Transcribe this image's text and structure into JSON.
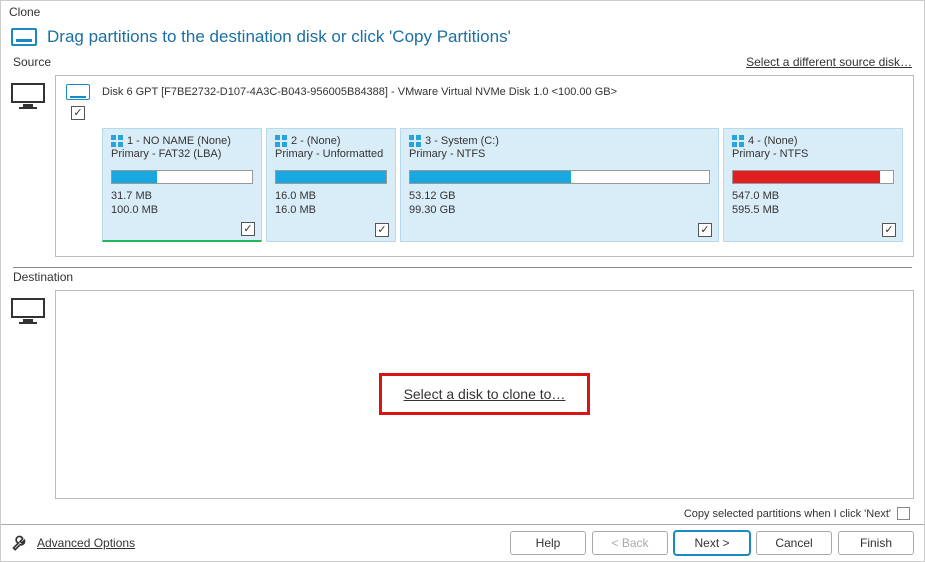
{
  "window": {
    "title": "Clone"
  },
  "instruction": "Drag partitions to the destination disk or click 'Copy Partitions'",
  "source": {
    "label": "Source",
    "select_other_link": "Select a different source disk…",
    "disk_title": "Disk 6 GPT [F7BE2732-D107-4A3C-B043-956005B84388] - VMware Virtual NVMe Disk 1.0  <100.00 GB>",
    "partitions": [
      {
        "title": "1 - NO NAME (None)",
        "type": "Primary - FAT32 (LBA)",
        "used": "31.7 MB",
        "total": "100.0 MB",
        "fill_pct": 32,
        "color": "blue",
        "checked": true
      },
      {
        "title": "2 -   (None)",
        "type": "Primary - Unformatted",
        "used": "16.0 MB",
        "total": "16.0 MB",
        "fill_pct": 100,
        "color": "blue",
        "checked": true
      },
      {
        "title": "3 - System (C:)",
        "type": "Primary - NTFS",
        "used": "53.12 GB",
        "total": "99.30 GB",
        "fill_pct": 54,
        "color": "blue",
        "checked": true
      },
      {
        "title": "4 -   (None)",
        "type": "Primary - NTFS",
        "used": "547.0 MB",
        "total": "595.5 MB",
        "fill_pct": 92,
        "color": "red",
        "checked": true
      }
    ]
  },
  "destination": {
    "label": "Destination",
    "select_link": "Select a disk to clone to…"
  },
  "copy_checkbox_label": "Copy selected partitions when I click 'Next'",
  "footer": {
    "advanced": "Advanced Options",
    "help": "Help",
    "back": "< Back",
    "next": "Next >",
    "cancel": "Cancel",
    "finish": "Finish"
  }
}
